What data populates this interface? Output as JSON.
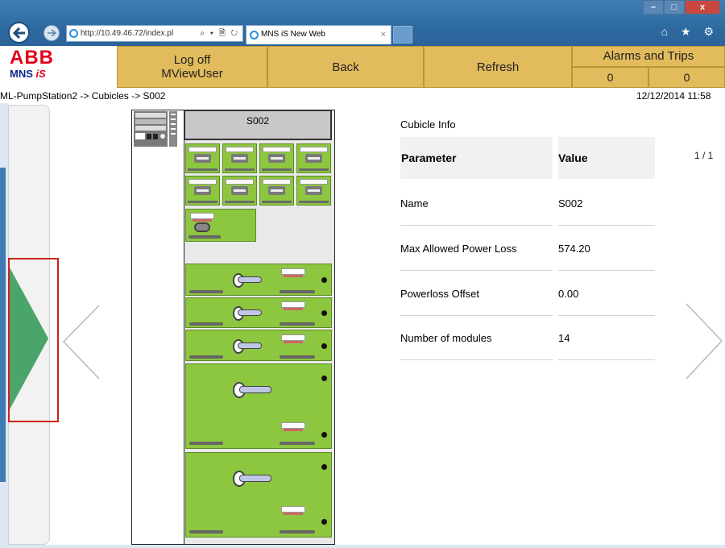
{
  "browser": {
    "url": "http://10.49.46.72/index.pl",
    "tab_title": "MNS iS New Web",
    "tab_close": "×",
    "address_controls": "⌕ ▾ 🗎 ↻",
    "window_controls": {
      "minimize": "–",
      "maximize": "□",
      "close": "x"
    },
    "toolbar_icons": "⌂ ★ ⚙"
  },
  "logo": {
    "brand": "ABB",
    "product_prefix": "MNS ",
    "product_suffix": "iS"
  },
  "header": {
    "logoff_line1": "Log off",
    "logoff_line2": "MViewUser",
    "back_label": "Back",
    "refresh_label": "Refresh",
    "alarms_title": "Alarms and Trips",
    "alarms_count": "0",
    "trips_count": "0"
  },
  "breadcrumb": "ML-PumpStation2 -> Cubicles -> S002",
  "datetime": "12/12/2014 11:58",
  "cubicle": {
    "title": "S002"
  },
  "info": {
    "heading": "Cubicle Info",
    "col_parameter": "Parameter",
    "col_value": "Value",
    "page_indicator": "1 / 1",
    "rows": [
      {
        "parameter": "Name",
        "value": "S002"
      },
      {
        "parameter": "Max Allowed Power Loss",
        "value": "574.20"
      },
      {
        "parameter": "Powerloss Offset",
        "value": "0.00"
      },
      {
        "parameter": "Number of modules",
        "value": "14"
      }
    ]
  },
  "colors": {
    "accent_button": "#e1bb5c",
    "module_green": "#8dc63f",
    "arrow_green": "#4aa56a",
    "highlight_red": "#d0201e",
    "abb_red": "#e2001a"
  }
}
